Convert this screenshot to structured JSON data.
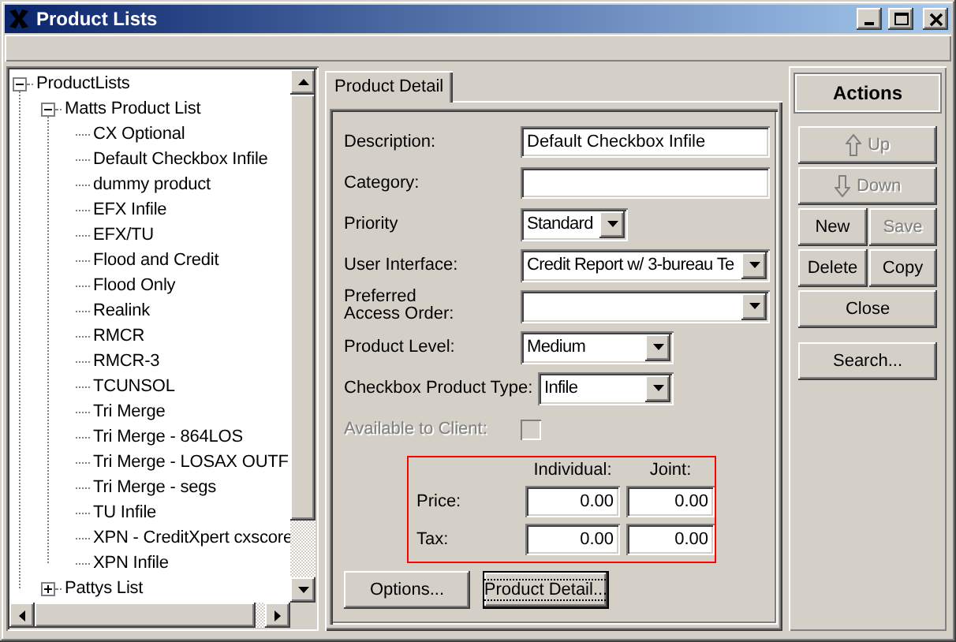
{
  "window": {
    "title": "Product Lists"
  },
  "tree": {
    "items": [
      {
        "label": "ProductLists",
        "expanded": true,
        "children": [
          {
            "label": "Matts Product List",
            "expanded": true,
            "children": [
              {
                "label": "CX Optional"
              },
              {
                "label": "Default Checkbox Infile"
              },
              {
                "label": "dummy product"
              },
              {
                "label": "EFX Infile"
              },
              {
                "label": "EFX/TU"
              },
              {
                "label": "Flood and Credit"
              },
              {
                "label": "Flood Only"
              },
              {
                "label": "Realink"
              },
              {
                "label": "RMCR"
              },
              {
                "label": "RMCR-3"
              },
              {
                "label": "TCUNSOL"
              },
              {
                "label": "Tri Merge"
              },
              {
                "label": "Tri Merge - 864LOS"
              },
              {
                "label": "Tri Merge - LOSAX OUTF"
              },
              {
                "label": "Tri Merge - segs"
              },
              {
                "label": "TU Infile"
              },
              {
                "label": "XPN - CreditXpert cxscore"
              },
              {
                "label": "XPN Infile"
              }
            ]
          },
          {
            "label": "Pattys List",
            "expanded": false
          }
        ]
      }
    ]
  },
  "tabs": [
    {
      "label": "Product Detail",
      "selected": true
    }
  ],
  "form": {
    "fields": [
      {
        "kind": "text",
        "label": "Description:",
        "value": "Default Checkbox Infile"
      },
      {
        "kind": "text",
        "label": "Category:"
      },
      {
        "kind": "select",
        "label": "Priority",
        "value": "Standard"
      },
      {
        "kind": "select",
        "label": "User Interface:",
        "value": "Credit Report w/ 3-bureau Te"
      },
      {
        "kind": "select",
        "label": "Preferred\nAccess Order:"
      },
      {
        "kind": "select",
        "label": "Product Level:",
        "value": "Medium"
      },
      {
        "kind": "select",
        "label": "Checkbox Product Type:",
        "value": "Infile"
      },
      {
        "kind": "checkbox",
        "label": "Available to Client:",
        "checked": false,
        "disabled": true
      }
    ],
    "pricing": {
      "columns": [
        "Individual:",
        "Joint:"
      ],
      "rows": [
        {
          "label": "Price:",
          "values": [
            "0.00",
            "0.00"
          ]
        },
        {
          "label": "Tax:",
          "values": [
            "0.00",
            "0.00"
          ]
        }
      ]
    },
    "buttons": [
      {
        "label": "Options...",
        "focused": false
      },
      {
        "label": "Product Detail...",
        "focused": true
      }
    ]
  },
  "actions": {
    "title": "Actions",
    "rows": [
      [
        {
          "label": "Up",
          "kind": "up-arrow",
          "disabled": true
        }
      ],
      [
        {
          "label": "Down",
          "kind": "down-arrow",
          "disabled": true
        }
      ],
      [
        {
          "label": "New",
          "kind": "plain",
          "disabled": false
        },
        {
          "label": "Save",
          "kind": "plain",
          "disabled": true
        }
      ],
      [
        {
          "label": "Delete",
          "kind": "plain",
          "disabled": false
        },
        {
          "label": "Copy",
          "kind": "plain",
          "disabled": false
        }
      ],
      [
        {
          "label": "Close",
          "kind": "plain",
          "disabled": false
        }
      ]
    ],
    "search": {
      "label": "Search...",
      "disabled": false
    }
  }
}
